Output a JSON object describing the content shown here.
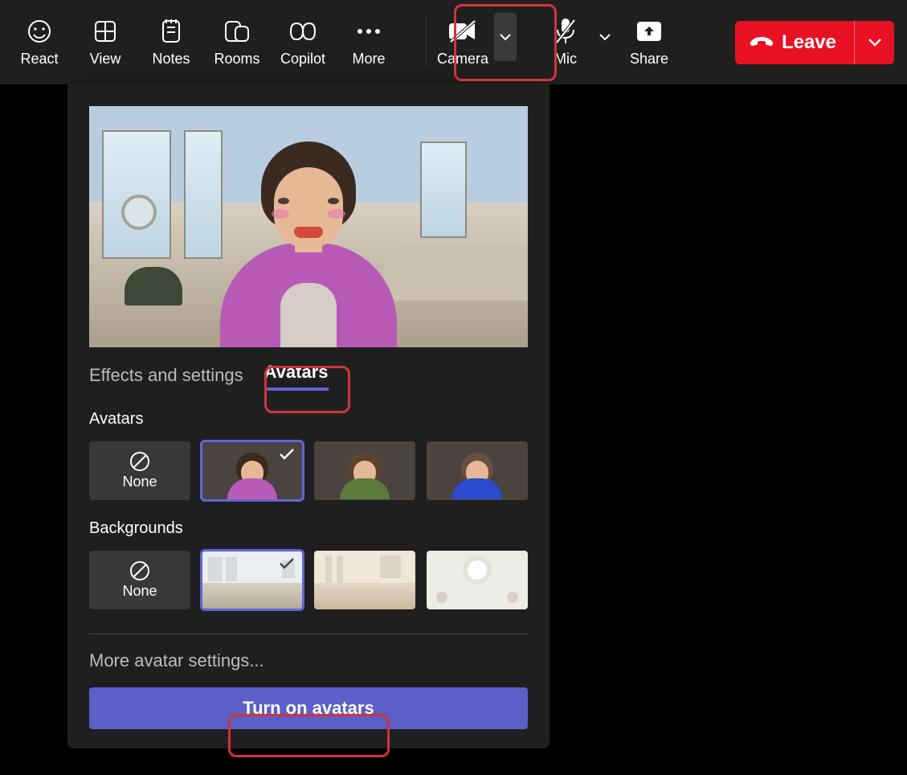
{
  "toolbar": {
    "react": "React",
    "view": "View",
    "notes": "Notes",
    "rooms": "Rooms",
    "copilot": "Copilot",
    "more": "More",
    "camera": "Camera",
    "mic": "Mic",
    "share": "Share",
    "leave": "Leave"
  },
  "panel": {
    "tabs": {
      "effects": "Effects and settings",
      "avatars": "Avatars"
    },
    "active_tab": "Avatars",
    "avatars_label": "Avatars",
    "none_label": "None",
    "backgrounds_label": "Backgrounds",
    "more_settings": "More avatar settings...",
    "turn_on": "Turn on avatars",
    "avatar_options": [
      {
        "id": "none"
      },
      {
        "id": "avatar-purple",
        "selected": true
      },
      {
        "id": "avatar-green"
      },
      {
        "id": "avatar-blue"
      }
    ],
    "background_options": [
      {
        "id": "none"
      },
      {
        "id": "modern-room",
        "selected": true
      },
      {
        "id": "wood-interior"
      },
      {
        "id": "white-dome"
      }
    ]
  },
  "highlights": [
    "camera-button",
    "avatars-tab",
    "turn-on-avatars-button"
  ]
}
